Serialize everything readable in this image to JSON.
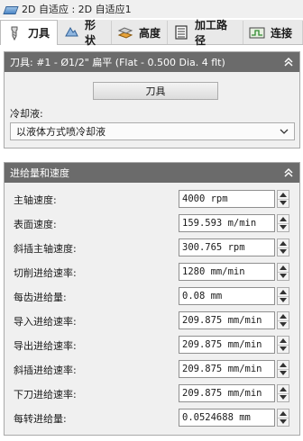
{
  "window": {
    "title": "2D 自适应 : 2D 自适应1"
  },
  "tabs": [
    {
      "label": "刀具",
      "icon": "tool-icon",
      "active": true
    },
    {
      "label": "形状",
      "icon": "shape-icon",
      "active": false
    },
    {
      "label": "高度",
      "icon": "height-icon",
      "active": false
    },
    {
      "label": "加工路径",
      "icon": "toolpath-icon",
      "active": false
    },
    {
      "label": "连接",
      "icon": "linking-icon",
      "active": false
    }
  ],
  "tool_panel": {
    "header": "刀具: #1 - Ø1/2\" 扁平 (Flat - 0.500 Dia. 4 flt)",
    "tool_button": "刀具",
    "coolant_label": "冷却液:",
    "coolant_value": "以液体方式喷冷却液"
  },
  "feed_panel": {
    "header": "进给量和速度",
    "rows": [
      {
        "label": "主轴速度:",
        "value": "4000 rpm"
      },
      {
        "label": "表面速度:",
        "value": "159.593 m/min"
      },
      {
        "label": "斜插主轴速度:",
        "value": "300.765 rpm"
      },
      {
        "label": "切削进给速率:",
        "value": "1280 mm/min"
      },
      {
        "label": "每齿进给量:",
        "value": "0.08 mm"
      },
      {
        "label": "导入进给速率:",
        "value": "209.875 mm/min"
      },
      {
        "label": "导出进给速率:",
        "value": "209.875 mm/min"
      },
      {
        "label": "斜插进给速率:",
        "value": "209.875 mm/min"
      },
      {
        "label": "下刀进给速率:",
        "value": "209.875 mm/min"
      },
      {
        "label": "每转进给量:",
        "value": "0.0524688 mm"
      }
    ]
  },
  "colors": {
    "panel_header_bg": "#6b6b6b",
    "panel_bg": "#f0f0f0",
    "tab_strip_bg": "#e9e9e9"
  }
}
